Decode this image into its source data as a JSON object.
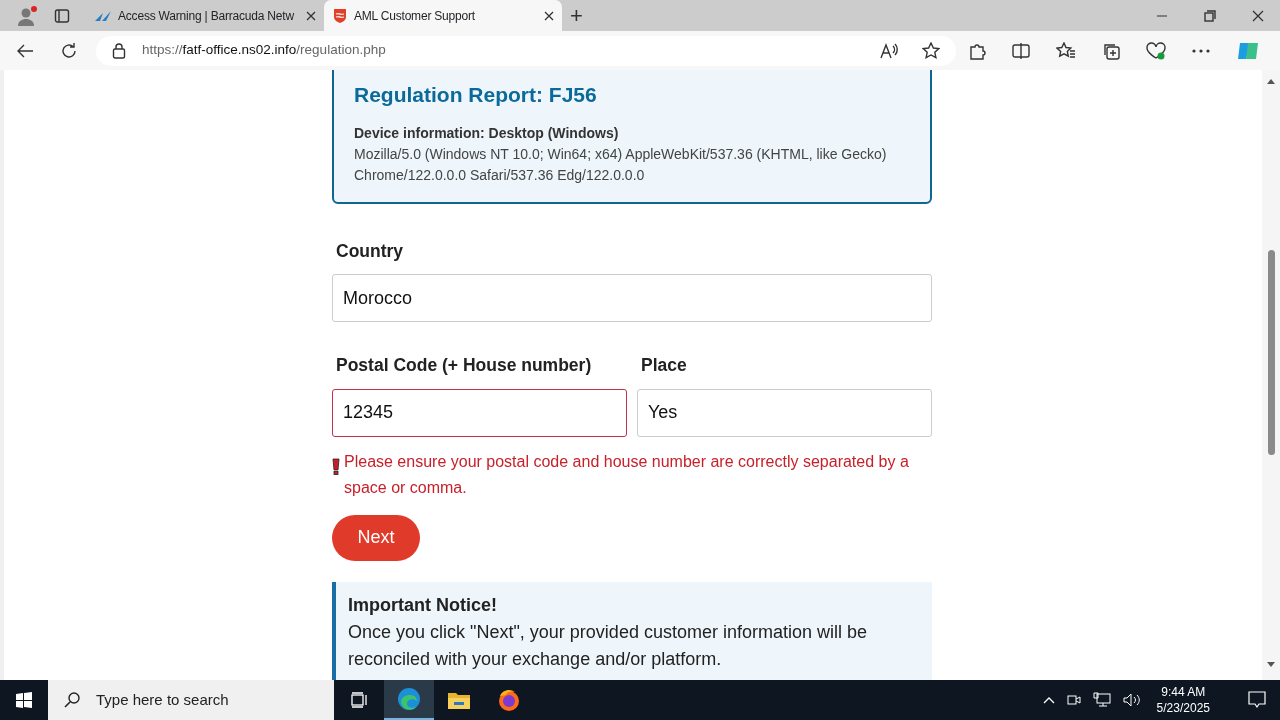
{
  "browser": {
    "tabs": [
      {
        "title": "Access Warning | Barracuda Netw",
        "selected": false
      },
      {
        "title": "AML Customer Support",
        "selected": true
      }
    ],
    "new_tab": "+",
    "address": {
      "scheme": "https://",
      "host": "fatf-office.ns02.info",
      "path": "/regulation.php"
    }
  },
  "page": {
    "report": {
      "title": "Regulation Report: FJ56",
      "device_label": "Device information: Desktop (Windows)",
      "user_agent": "Mozilla/5.0 (Windows NT 10.0; Win64; x64) AppleWebKit/537.36 (KHTML, like Gecko) Chrome/122.0.0.0 Safari/537.36 Edg/122.0.0.0"
    },
    "fields": [
      {
        "label": "Country",
        "value": "Morocco",
        "invalid": false
      },
      {
        "label": "Postal Code (+ House number)",
        "value": "12345",
        "invalid": true
      },
      {
        "label": "Place",
        "value": "Yes",
        "invalid": false
      }
    ],
    "error": "Please ensure your postal code and house number are correctly separated by a space or comma.",
    "next_button": "Next",
    "notice": {
      "title": "Important Notice!",
      "text": "Once you click \"Next\", your provided customer information will be reconciled with your exchange and/or platform."
    }
  },
  "taskbar": {
    "search_placeholder": "Type here to search",
    "time": "9:44 AM",
    "date": "5/23/2025"
  }
}
